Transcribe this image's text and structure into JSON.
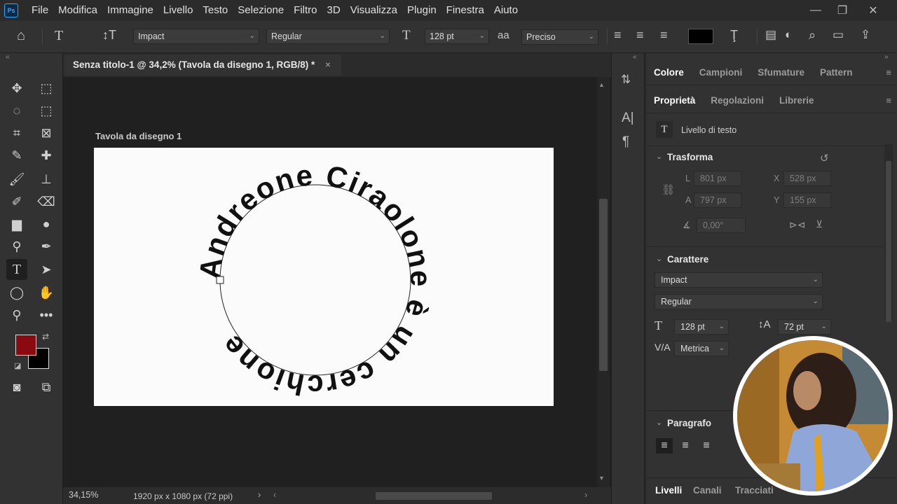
{
  "app": {
    "logo": "Ps"
  },
  "menu": [
    "File",
    "Modifica",
    "Immagine",
    "Livello",
    "Testo",
    "Selezione",
    "Filtro",
    "3D",
    "Visualizza",
    "Plugin",
    "Finestra",
    "Aiuto"
  ],
  "options": {
    "font_family": "Impact",
    "font_style": "Regular",
    "font_size": "128 pt",
    "aa_icon": "aa",
    "antialias": "Preciso",
    "color": "#000000"
  },
  "document": {
    "tab_title": "Senza titolo-1 @ 34,2% (Tavola da disegno 1, RGB/8) *",
    "close": "×",
    "artboard_label": "Tavola da disegno 1",
    "path_text": "Andreone Ciraolone è un cerchione"
  },
  "status": {
    "zoom": "34,15%",
    "doc_info": "1920 px x 1080 px (72 ppi)"
  },
  "colors": {
    "foreground": "#8b0a10",
    "background": "#000000",
    "accent": "#31a8ff"
  },
  "panels": {
    "top_tabs": [
      "Colore",
      "Campioni",
      "Sfumature",
      "Pattern"
    ],
    "prop_tabs": [
      "Proprietà",
      "Regolazioni",
      "Librerie"
    ],
    "layer_type": "Livello di testo",
    "transform": {
      "title": "Trasforma",
      "w_label": "L",
      "w": "801 px",
      "h_label": "A",
      "h": "797 px",
      "x_label": "X",
      "x": "528 px",
      "y_label": "Y",
      "y": "155 px",
      "angle": "0,00°"
    },
    "character": {
      "title": "Carattere",
      "font": "Impact",
      "style": "Regular",
      "size": "128 pt",
      "leading": "72 pt",
      "kerning": "Metrica"
    },
    "paragraph": {
      "title": "Paragrafo"
    },
    "bottom_tabs": [
      "Livelli",
      "Canali",
      "Tracciati"
    ]
  }
}
